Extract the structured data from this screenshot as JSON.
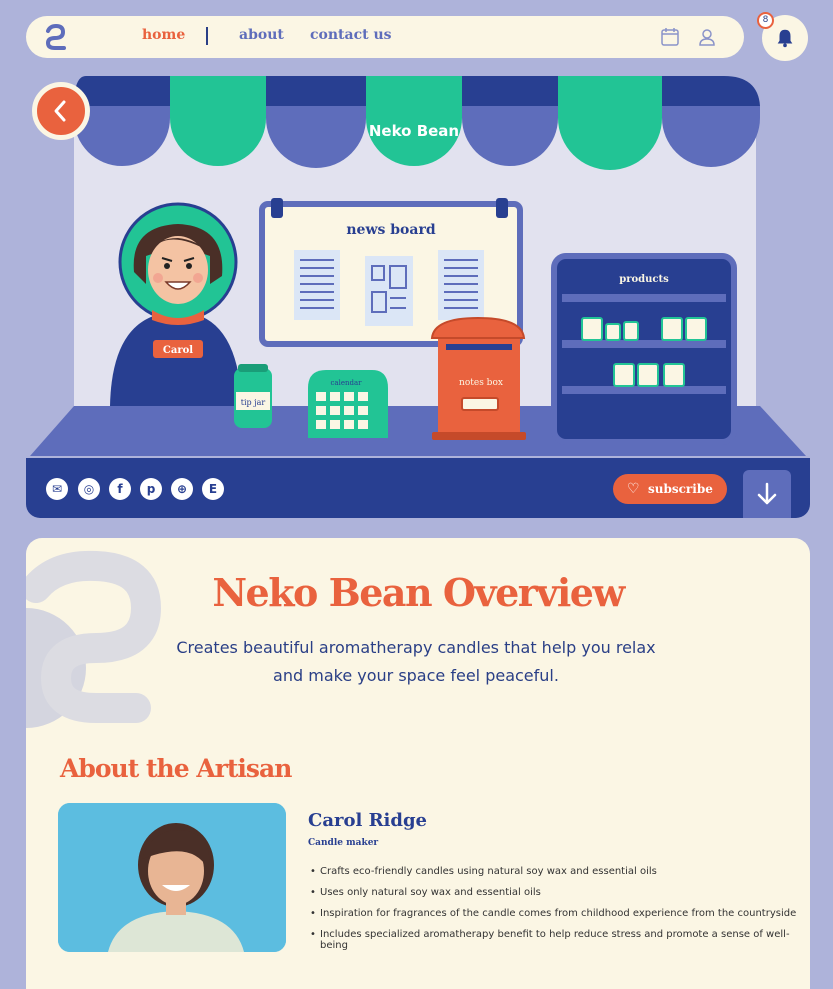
{
  "nav": {
    "links": [
      "home",
      "about",
      "contact us"
    ],
    "active": "home",
    "icons": [
      "calendar-icon",
      "user-icon",
      "bell-icon"
    ],
    "notification_count": "8"
  },
  "hero": {
    "brand": "Neko Bean",
    "news_board": "news board",
    "products_label": "products",
    "character_name": "Carol",
    "tip_jar": "tip jar",
    "calendar": "calendar",
    "notes_box": "notes box",
    "subscribe": "subscribe",
    "social": [
      "mail-icon",
      "instagram-icon",
      "facebook-icon",
      "pinterest-icon",
      "globe-icon",
      "etsy-icon"
    ]
  },
  "overview": {
    "title": "Neko Bean Overview",
    "description": "Creates beautiful aromatherapy candles that help you relax and make your space feel peaceful."
  },
  "artisan": {
    "heading": "About the Artisan",
    "name": "Carol Ridge",
    "role": "Candle maker",
    "bullets": [
      "Crafts eco-friendly candles using natural soy wax and essential oils",
      "Uses only natural soy wax and essential oils",
      "Inspiration for fragrances of the candle comes from childhood experience from the countryside",
      "Includes specialized aromatherapy benefit to help reduce stress and promote a sense of well-being"
    ]
  },
  "colors": {
    "accent": "#e9623e",
    "navy": "#283f91",
    "green": "#22c495",
    "cream": "#fbf6e4",
    "bg": "#aeb3da"
  }
}
